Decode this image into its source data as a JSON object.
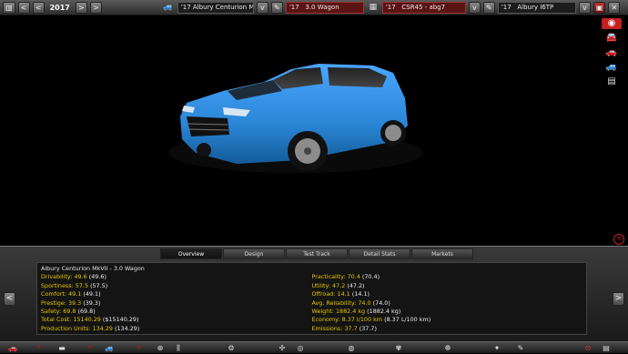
{
  "topbar": {
    "year": "2017",
    "model_year": "'17",
    "model_name": "Albury Centurion MkVII",
    "trim_year": "'17",
    "trim_name": "3.0 Wagon",
    "engine_year": "'17",
    "engine_name": "CSR45 - abg7",
    "engine_family_year": "'17",
    "engine_family_name": "Albury I6TP"
  },
  "tabs": [
    "Overview",
    "Design",
    "Test Track",
    "Detail Stats",
    "Markets"
  ],
  "stats": {
    "title": "Albury Centurion MkVII - 3.0 Wagon",
    "left": [
      {
        "k": "Drivability:",
        "v": "49.6",
        "r": "(49.6)"
      },
      {
        "k": "Sportiness:",
        "v": "57.5",
        "r": "(57.5)"
      },
      {
        "k": "Comfort:",
        "v": "49.1",
        "r": "(49.1)"
      },
      {
        "k": "Prestige:",
        "v": "39.3",
        "r": "(39.3)"
      },
      {
        "k": "Safety:",
        "v": "69.8",
        "r": "(69.8)"
      },
      {
        "k": "Total Cost:",
        "v": "15140.29",
        "r": "($15140.29)"
      },
      {
        "k": "Production Units:",
        "v": "134.29",
        "r": "(134.29)"
      }
    ],
    "right": [
      {
        "k": "Practicality:",
        "v": "70.4",
        "r": "(70.4)"
      },
      {
        "k": "Utility:",
        "v": "47.2",
        "r": "(47.2)"
      },
      {
        "k": "Offroad:",
        "v": "14.1",
        "r": "(14.1)"
      },
      {
        "k": "Avg. Reliability:",
        "v": "74.0",
        "r": "(74.0)"
      },
      {
        "k": "Weight:",
        "v": "1882.4 kg",
        "r": "(1882.4 kg)"
      },
      {
        "k": "Economy:",
        "v": "8.37 l/100 km",
        "r": "(8.37 L/100 km)"
      },
      {
        "k": "Emissions:",
        "v": "37.7",
        "r": "(37.7)"
      }
    ]
  },
  "colors": {
    "car_body": "#2a86d6",
    "accent_red": "#c42020"
  }
}
